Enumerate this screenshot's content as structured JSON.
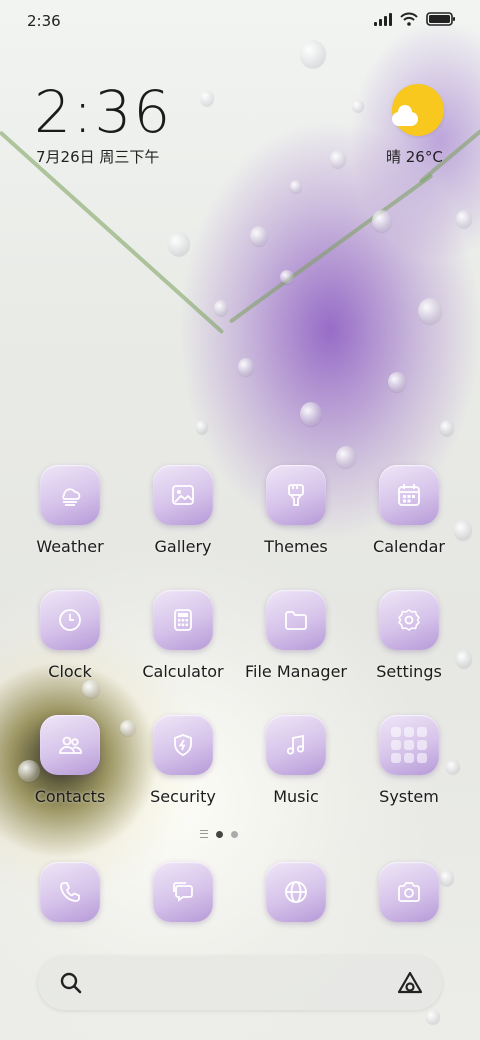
{
  "status_bar": {
    "time": "2:36"
  },
  "clock_widget": {
    "time": "2:36",
    "date": "7月26日 周三下午"
  },
  "weather_widget": {
    "condition_temp": "晴 26°C",
    "icon": "sun-cloud-icon",
    "sun_color": "#f8c81f"
  },
  "apps": {
    "weather": "Weather",
    "gallery": "Gallery",
    "themes": "Themes",
    "calendar": "Calendar",
    "clock": "Clock",
    "calculator": "Calculator",
    "file_manager": "File Manager",
    "settings": "Settings",
    "contacts": "Contacts",
    "security": "Security",
    "music": "Music",
    "system": "System"
  },
  "dock": [
    "phone-icon",
    "messages-icon",
    "browser-icon",
    "camera-icon"
  ],
  "page_indicator": {
    "pages": 2,
    "active": 1
  },
  "search": {
    "placeholder": ""
  },
  "colors": {
    "icon_tile": "#d6c3ea",
    "icon_glyph": "#ffffff"
  }
}
